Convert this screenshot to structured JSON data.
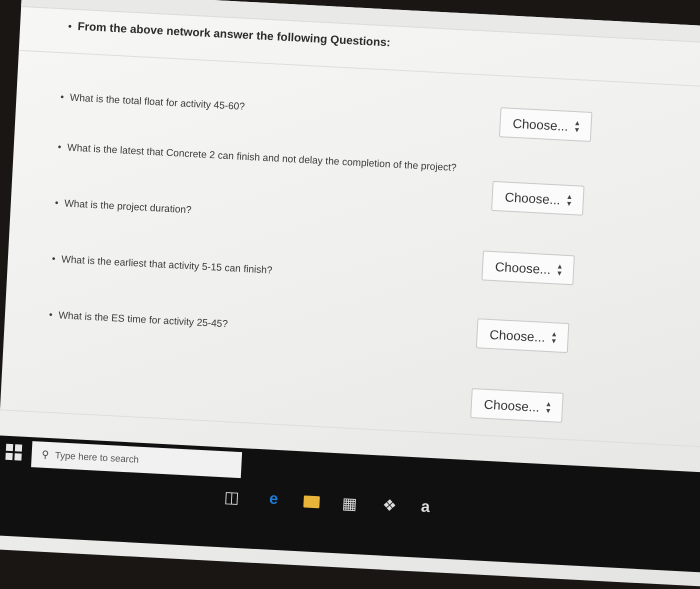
{
  "intro": {
    "bullet": "•",
    "text": "From the above network answer the following Questions:"
  },
  "questions": [
    {
      "text": "What is the total float for activity 45-60?",
      "select": "Choose..."
    },
    {
      "text": "What is the latest that Concrete 2 can finish and not delay the completion of the project?",
      "select": "Choose..."
    },
    {
      "text": "What is the project duration?",
      "select": "Choose..."
    },
    {
      "text": "What is the earliest that activity 5-15 can finish?",
      "select": "Choose..."
    },
    {
      "text": "What is the ES time for activity 25-45?",
      "select": "Choose..."
    }
  ],
  "taskbar": {
    "search_placeholder": "Type here to search",
    "icons": [
      "windows-icon",
      "task-view-icon",
      "edge-icon",
      "file-explorer-icon",
      "store-icon",
      "dropbox-icon",
      "amazon-icon"
    ]
  },
  "colors": {
    "screen_bg": "#f2f2f0",
    "taskbar_bg": "#101010",
    "edge_blue": "#1f7bd6",
    "explorer_yellow": "#e8b43a"
  }
}
